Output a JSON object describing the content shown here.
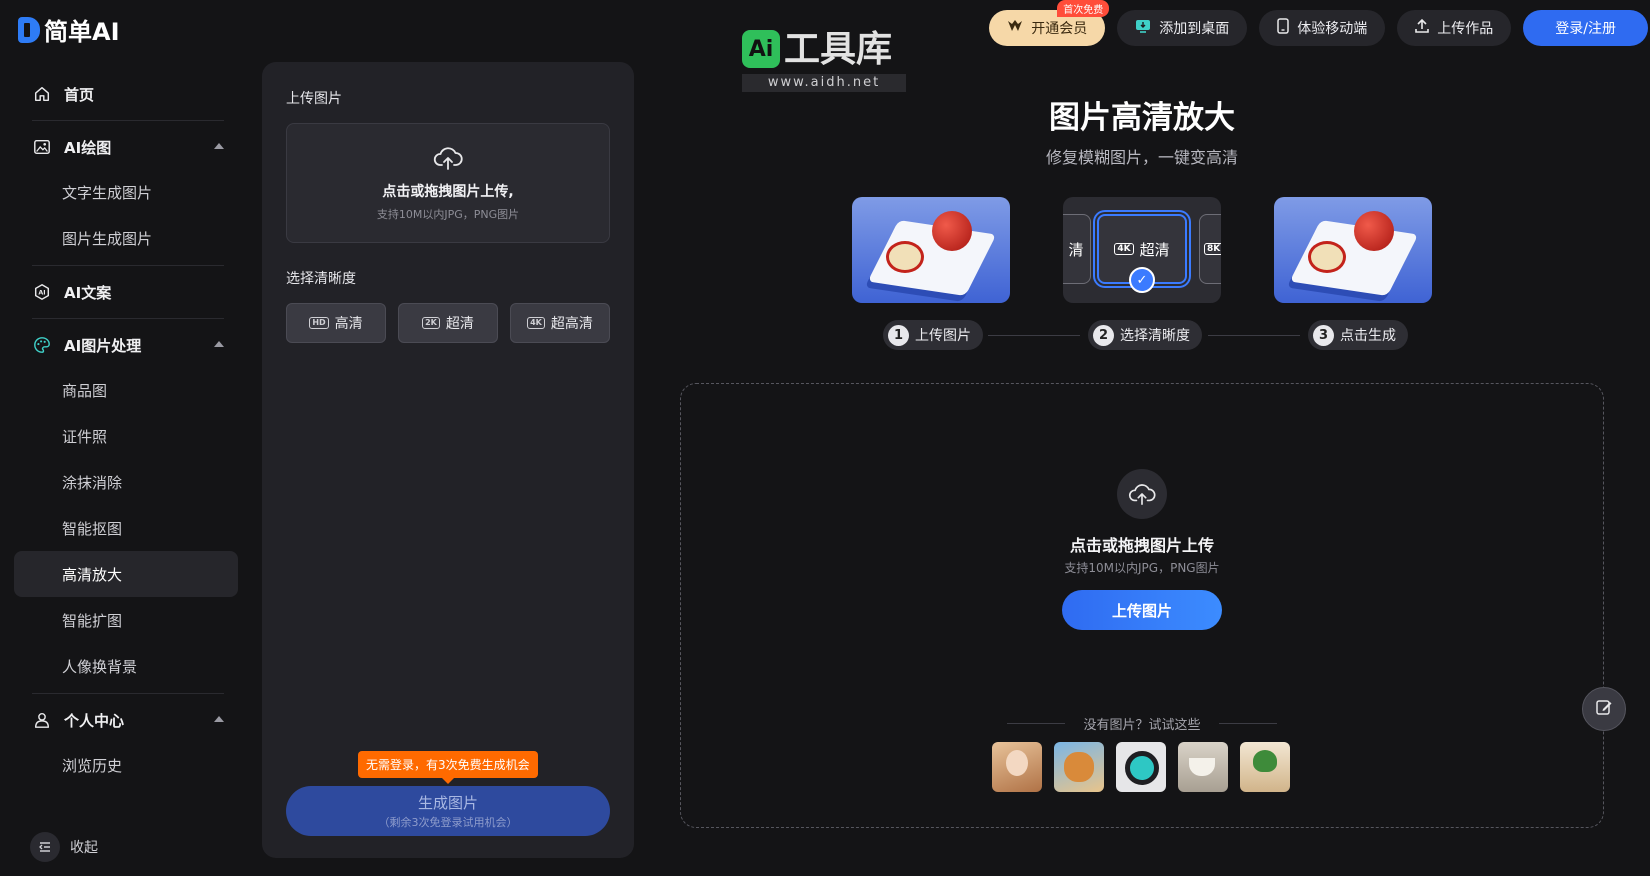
{
  "brand": {
    "name": "简单AI"
  },
  "sidebar": {
    "home": "首页",
    "ai_drawing": {
      "label": "AI绘图",
      "items": [
        "文字生成图片",
        "图片生成图片"
      ]
    },
    "ai_copy": "AI文案",
    "ai_image": {
      "label": "AI图片处理",
      "items": [
        "商品图",
        "证件照",
        "涂抹消除",
        "智能抠图",
        "高清放大",
        "智能扩图",
        "人像换背景"
      ],
      "active": "高清放大"
    },
    "personal": {
      "label": "个人中心",
      "items": [
        "浏览历史"
      ]
    },
    "collapse": "收起"
  },
  "topbar": {
    "vip": "开通会员",
    "vip_tag": "首次免费",
    "add_desktop": "添加到桌面",
    "mobile": "体验移动端",
    "upload_work": "上传作品",
    "login": "登录/注册"
  },
  "watermark": {
    "logo": "Ai",
    "text": "工具库",
    "url": "www.aidh.net"
  },
  "panel": {
    "upload_label": "上传图片",
    "upload_main": "点击或拖拽图片上传,",
    "upload_hint": "支持10M以内JPG，PNG图片",
    "quality_label": "选择清晰度",
    "qualities": [
      {
        "badge": "HD",
        "label": "高清"
      },
      {
        "badge": "2K",
        "label": "超清"
      },
      {
        "badge": "4K",
        "label": "超高清"
      }
    ],
    "tip": "无需登录，有3次免费生成机会",
    "generate": "生成图片",
    "generate_sub": "（剩余3次免登录试用机会）"
  },
  "main": {
    "title": "图片高清放大",
    "subtitle": "修复模糊图片，一键变高清",
    "step2_card": {
      "badge": "4K",
      "label": "超清",
      "left_label": "清",
      "right_badge": "8K"
    },
    "steps": [
      {
        "num": "1",
        "label": "上传图片"
      },
      {
        "num": "2",
        "label": "选择清晰度"
      },
      {
        "num": "3",
        "label": "点击生成"
      }
    ],
    "drop_main": "点击或拖拽图片上传",
    "drop_hint": "支持10M以内JPG，PNG图片",
    "drop_button": "上传图片",
    "try_label": "没有图片？试试这些"
  },
  "colors": {
    "accent": "#2f6bf1",
    "vip": "#f6d8a8",
    "tip": "#ff6a00"
  }
}
